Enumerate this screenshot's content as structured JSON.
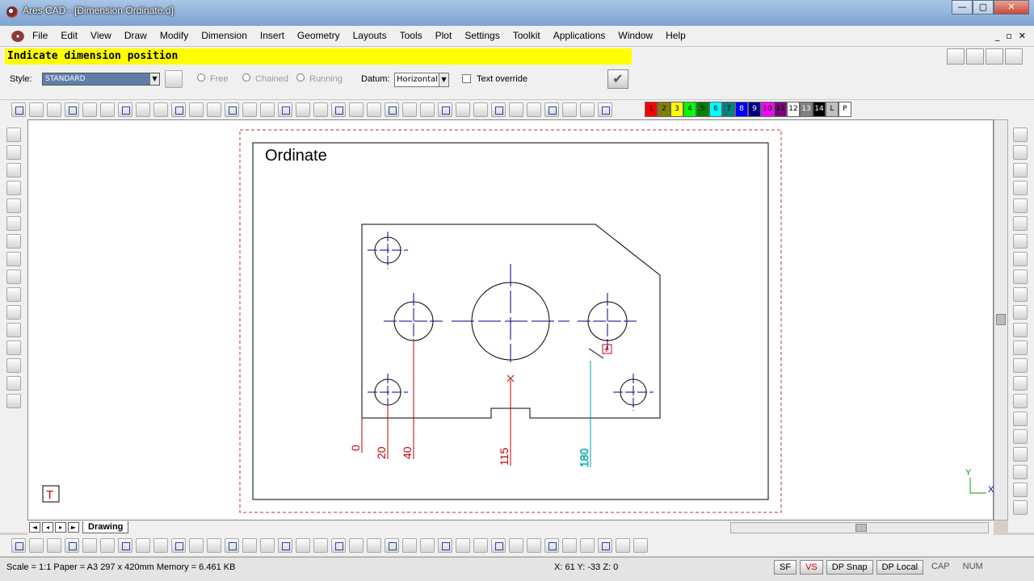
{
  "window": {
    "title": "Ares CAD - [Dimension Ordinate.d]",
    "buttons": [
      "—",
      "▢",
      "✕"
    ]
  },
  "menu": [
    "File",
    "Edit",
    "View",
    "Draw",
    "Modify",
    "Dimension",
    "Insert",
    "Geometry",
    "Layouts",
    "Tools",
    "Plot",
    "Settings",
    "Toolkit",
    "Applications",
    "Window",
    "Help"
  ],
  "mdi_buttons": [
    "_",
    "▫",
    "✕"
  ],
  "prompt": "Indicate dimension position",
  "options": {
    "style_label": "Style:",
    "style_value": "STANDARD",
    "free": "Free",
    "chained": "Chained",
    "running": "Running",
    "datum_label": "Datum:",
    "datum_value": "Horizontal",
    "text_override": "Text override",
    "ok": "✔"
  },
  "palette": [
    {
      "label": "1",
      "color": "#ff0000"
    },
    {
      "label": "2",
      "color": "#808000"
    },
    {
      "label": "3",
      "color": "#ffff00"
    },
    {
      "label": "4",
      "color": "#00ff00"
    },
    {
      "label": "5",
      "color": "#008000"
    },
    {
      "label": "6",
      "color": "#00ffff"
    },
    {
      "label": "7",
      "color": "#008080"
    },
    {
      "label": "8",
      "color": "#0000ff"
    },
    {
      "label": "9",
      "color": "#000080"
    },
    {
      "label": "10",
      "color": "#ff00ff"
    },
    {
      "label": "11",
      "color": "#800080"
    },
    {
      "label": "12",
      "color": "#ffffff"
    },
    {
      "label": "13",
      "color": "#808080"
    },
    {
      "label": "14",
      "color": "#000000"
    },
    {
      "label": "L",
      "color": "#c0c0c0"
    },
    {
      "label": "P",
      "color": "#ffffff"
    }
  ],
  "drawing": {
    "title": "Ordinate",
    "labels": [
      "0",
      "20",
      "40",
      "115",
      "180"
    ],
    "axis_y": "Y",
    "axis_x": "X",
    "text_tool": "T",
    "colors": {
      "outline": "#000000",
      "centerline": "#00008b",
      "dimension": "#c00000",
      "preview": "#00a0a0"
    }
  },
  "tabs": {
    "active": "Drawing"
  },
  "status": {
    "info": "Scale = 1:1  Paper = A3 297 x 420mm  Memory = 6.461 KB",
    "coords": "X: 61 Y: -33 Z: 0",
    "buttons": [
      "SF",
      "VS",
      "DP Snap",
      "DP Local"
    ],
    "plain": [
      "CAP",
      "NUM"
    ]
  }
}
